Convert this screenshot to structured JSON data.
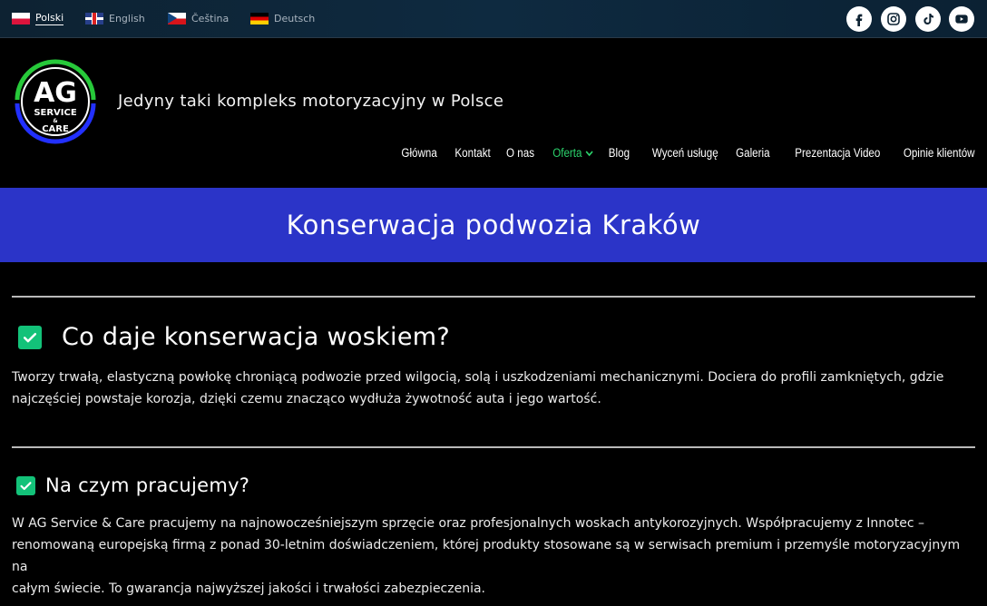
{
  "languages": [
    {
      "label": "Polski",
      "active": true
    },
    {
      "label": "English",
      "active": false
    },
    {
      "label": "Čeština",
      "active": false
    },
    {
      "label": "Deutsch",
      "active": false
    }
  ],
  "social": [
    "facebook-icon",
    "instagram-icon",
    "tiktok-icon",
    "youtube-icon"
  ],
  "logo": {
    "big": "AG",
    "line1": "SERVICE",
    "amp": "&",
    "line2": "CARE"
  },
  "tagline": "Jedyny taki kompleks motoryzacyjny w Polsce",
  "nav": [
    {
      "label": "Główna"
    },
    {
      "label": "Kontakt"
    },
    {
      "label": "O nas"
    },
    {
      "label": "Oferta"
    },
    {
      "label": "Blog"
    },
    {
      "label": "Wyceń usługę"
    },
    {
      "label": "Galeria"
    },
    {
      "label": "Prezentacja Video"
    },
    {
      "label": "Opinie klientów"
    }
  ],
  "banner_title": "Konserwacja podwozia Kraków",
  "sections": [
    {
      "title": "Co daje konserwacja woskiem?",
      "text_line1": "Tworzy trwałą, elastyczną powłokę chroniącą podwozie przed wilgocią, solą i uszkodzeniami mechanicznymi. Dociera do profili zamkniętych, gdzie",
      "text_line2": "najczęściej powstaje korozja, dzięki czemu znacząco wydłuża żywotność auta i jego wartość."
    },
    {
      "title": "Na czym pracujemy?",
      "text_line1": "W AG Service & Care pracujemy na najnowocześniejszym sprzęcie oraz profesjonalnych woskach antykorozyjnych. Współpracujemy z Innotec –",
      "text_line2": "renomowaną europejską firmą z ponad 30-letnim doświadczeniem, której produkty stosowane są w serwisach premium i przemyśle motoryzacyjnym na",
      "text_line3": "całym świecie. To gwarancja najwyższej jakości i trwałości zabezpieczenia."
    }
  ],
  "colors": {
    "banner": "#2b34c8",
    "accent": "#2bd36c",
    "check": "#13c279"
  }
}
